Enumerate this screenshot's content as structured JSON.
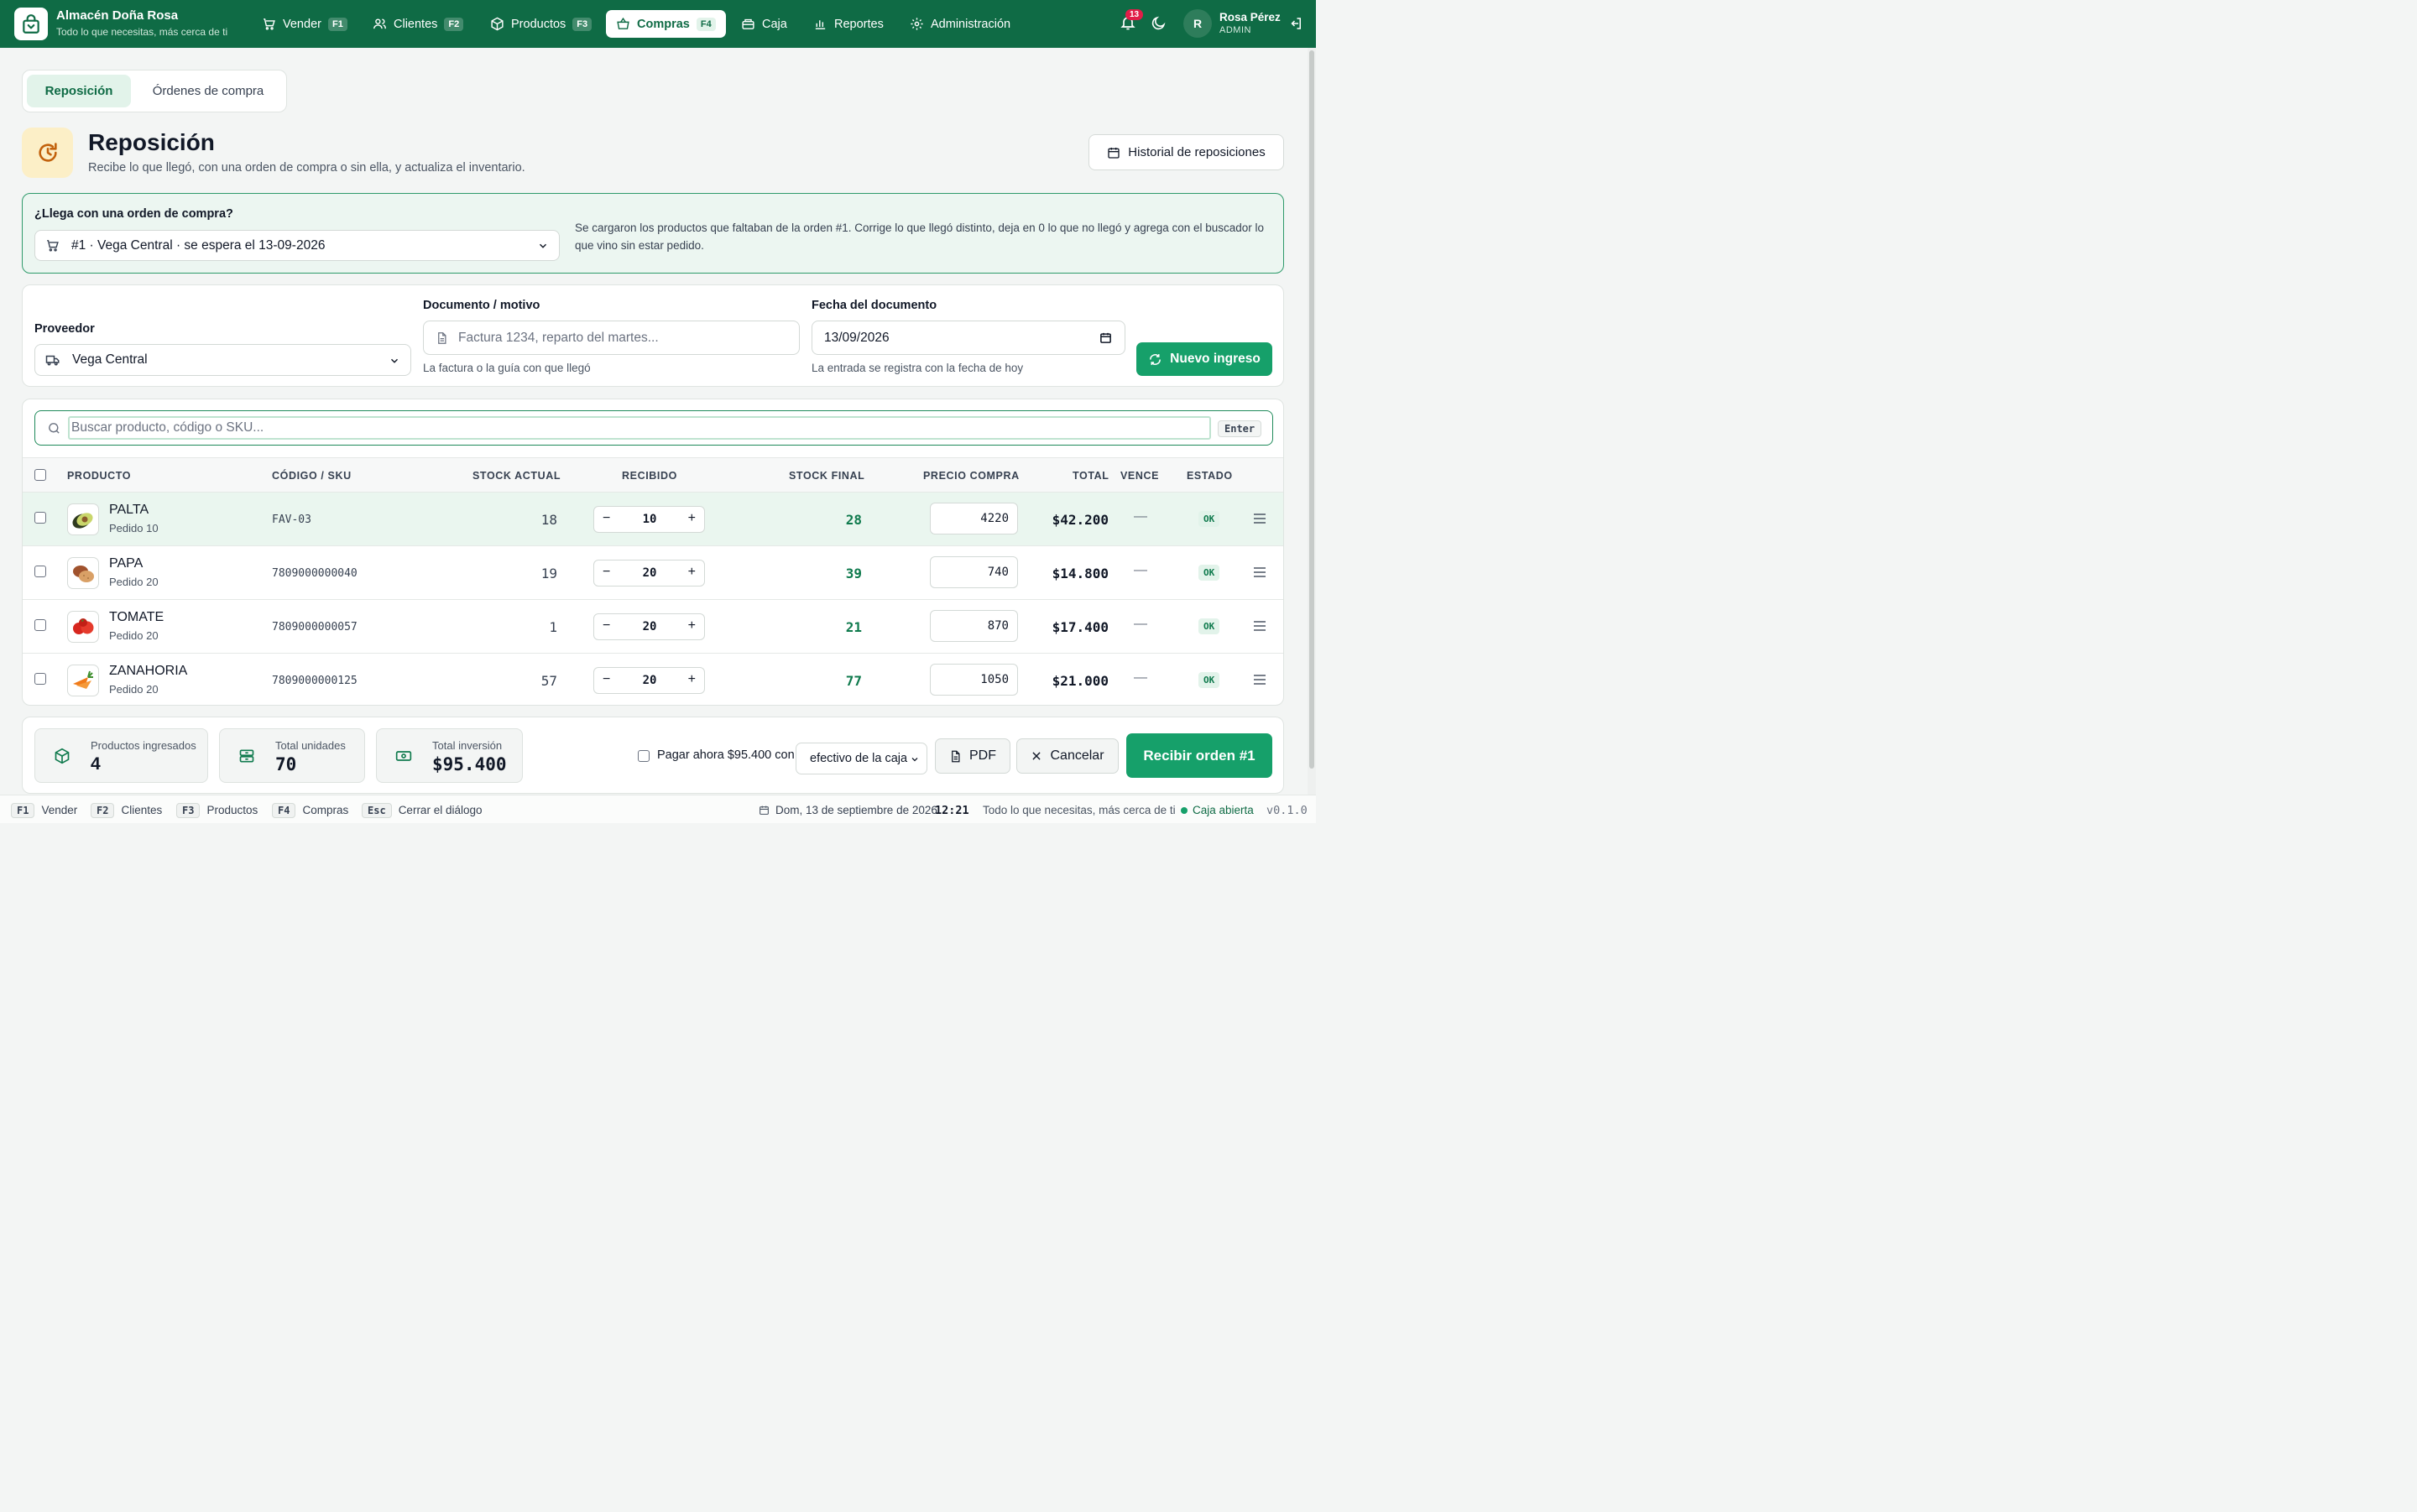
{
  "colors": {
    "brand": "#0f6b45",
    "accent": "#16a06a",
    "badge": "#e11d48",
    "highlight_row": "#eaf6ef"
  },
  "app": {
    "name": "Almacén Doña Rosa",
    "tagline": "Todo lo que necesitas, más cerca de ti"
  },
  "nav": [
    {
      "label": "Vender",
      "key": "F1",
      "icon": "cart-icon"
    },
    {
      "label": "Clientes",
      "key": "F2",
      "icon": "users-icon"
    },
    {
      "label": "Productos",
      "key": "F3",
      "icon": "box-icon"
    },
    {
      "label": "Compras",
      "key": "F4",
      "icon": "basket-icon",
      "active": true
    },
    {
      "label": "Caja",
      "key": "",
      "icon": "register-icon"
    },
    {
      "label": "Reportes",
      "key": "",
      "icon": "bar-chart-icon"
    },
    {
      "label": "Administración",
      "key": "",
      "icon": "gear-icon"
    }
  ],
  "notifications": {
    "count": "13"
  },
  "user": {
    "initial": "R",
    "name": "Rosa Pérez",
    "role": "ADMIN"
  },
  "tabs": [
    {
      "label": "Reposición",
      "active": true
    },
    {
      "label": "Órdenes de compra"
    }
  ],
  "header": {
    "title": "Reposición",
    "subtitle": "Recibe lo que llegó, con una orden de compra o sin ella, y actualiza el inventario.",
    "history_button": "Historial de reposiciones"
  },
  "order": {
    "question": "¿Llega con una orden de compra?",
    "selected": "#1 · Vega Central · se espera el 13-09-2026",
    "note": "Se cargaron los productos que faltaban de la orden #1. Corrige lo que llegó distinto, deja en 0 lo que no llegó y agrega con el buscador lo que vino sin estar pedido."
  },
  "form": {
    "supplier_label": "Proveedor",
    "supplier_value": "Vega Central",
    "document_label": "Documento / motivo",
    "document_placeholder": "Factura 1234, reparto del martes...",
    "document_help": "La factura o la guía con que llegó",
    "date_label": "Fecha del documento",
    "date_value": "13/09/2026",
    "date_help": "La entrada se registra con la fecha de hoy",
    "new_button": "Nuevo ingreso"
  },
  "search": {
    "placeholder": "Buscar producto, código o SKU...",
    "key": "Enter"
  },
  "table": {
    "columns": {
      "product": "PRODUCTO",
      "sku": "CÓDIGO / SKU",
      "stock": "STOCK ACTUAL",
      "received": "RECIBIDO",
      "final": "STOCK FINAL",
      "price": "PRECIO COMPRA",
      "total": "TOTAL",
      "expires": "VENCE",
      "status": "ESTADO"
    },
    "rows": [
      {
        "name": "PALTA",
        "ordered": "Pedido 10",
        "sku": "FAV-03",
        "stock": "18",
        "received": "10",
        "final": "28",
        "price": "4220",
        "total": "$42.200",
        "expires": "—",
        "status": "OK",
        "image": "avocado-icon"
      },
      {
        "name": "PAPA",
        "ordered": "Pedido 20",
        "sku": "7809000000040",
        "stock": "19",
        "received": "20",
        "final": "39",
        "price": "740",
        "total": "$14.800",
        "expires": "—",
        "status": "OK",
        "image": "potato-icon"
      },
      {
        "name": "TOMATE",
        "ordered": "Pedido 20",
        "sku": "7809000000057",
        "stock": "1",
        "received": "20",
        "final": "21",
        "price": "870",
        "total": "$17.400",
        "expires": "—",
        "status": "OK",
        "image": "tomato-icon"
      },
      {
        "name": "ZANAHORIA",
        "ordered": "Pedido 20",
        "sku": "7809000000125",
        "stock": "57",
        "received": "20",
        "final": "77",
        "price": "1050",
        "total": "$21.000",
        "expires": "—",
        "status": "OK",
        "image": "carrot-icon"
      }
    ]
  },
  "summary": {
    "products_label": "Productos ingresados",
    "products_value": "4",
    "units_label": "Total unidades",
    "units_value": "70",
    "investment_label": "Total inversión",
    "investment_value": "$95.400",
    "pay_label": "Pagar ahora $95.400 con",
    "pay_method": "efectivo de la caja",
    "pdf_button": "PDF",
    "cancel_button": "Cancelar",
    "receive_button": "Recibir orden #1"
  },
  "statusbar": {
    "shortcuts": [
      {
        "key": "F1",
        "label": "Vender"
      },
      {
        "key": "F2",
        "label": "Clientes"
      },
      {
        "key": "F3",
        "label": "Productos"
      },
      {
        "key": "F4",
        "label": "Compras"
      },
      {
        "key": "Esc",
        "label": "Cerrar el diálogo"
      }
    ],
    "date": "Dom, 13 de septiembre de 2026",
    "time": "12:21",
    "tagline": "Todo lo que necesitas, más cerca de ti",
    "register": "Caja abierta",
    "version": "v0.1.0"
  }
}
